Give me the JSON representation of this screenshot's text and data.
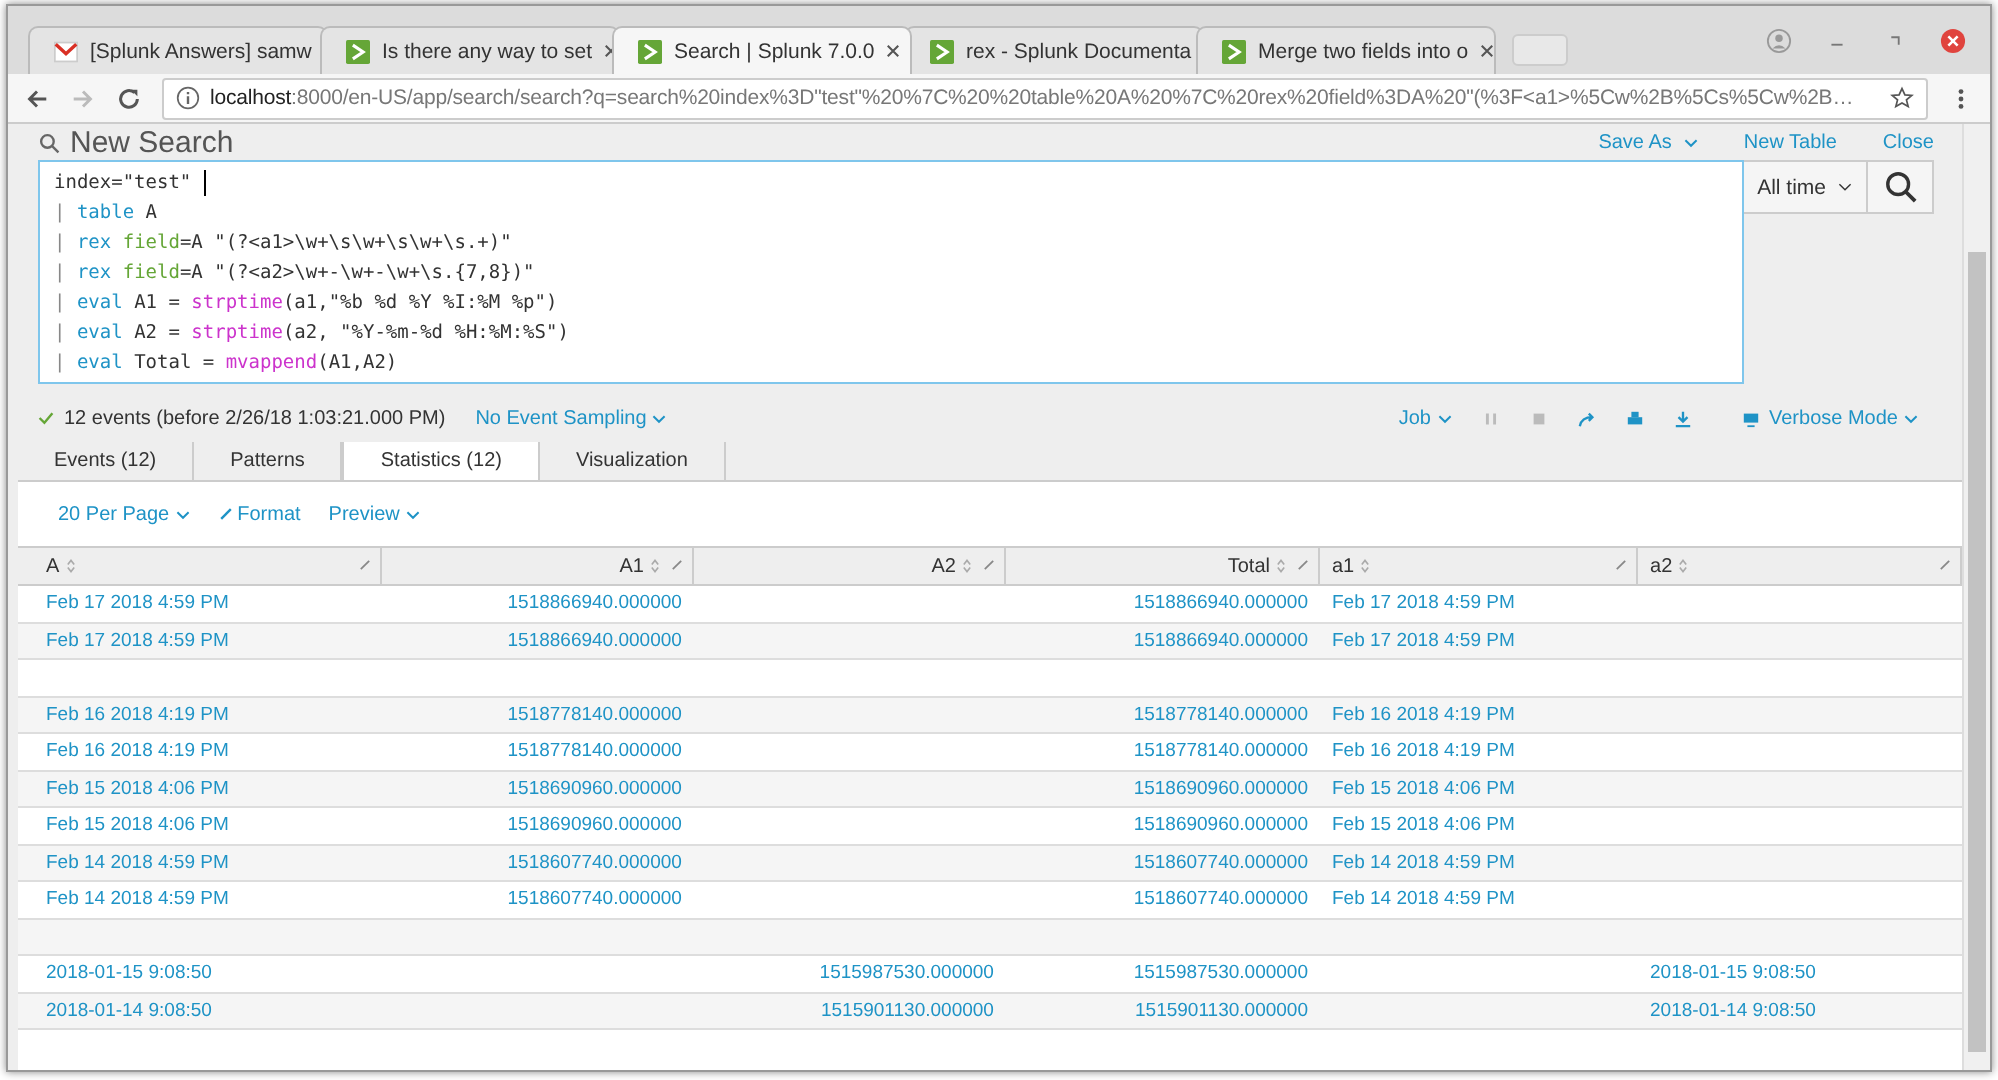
{
  "browser": {
    "tabs": [
      {
        "title": "[Splunk Answers] samw",
        "kind": "mail",
        "selected": false
      },
      {
        "title": "Is there any way to set",
        "kind": "splunk",
        "selected": false
      },
      {
        "title": "Search | Splunk 7.0.0",
        "kind": "splunk",
        "selected": true
      },
      {
        "title": "rex - Splunk Documenta",
        "kind": "splunk",
        "selected": false
      },
      {
        "title": "Merge two fields into o",
        "kind": "splunk",
        "selected": false
      }
    ],
    "url_host": "localhost",
    "url_rest": ":8000/en-US/app/search/search?q=search%20index%3D\"test\"%20%7C%20%20table%20A%20%7C%20rex%20field%3DA%20\"(%3F<a1>%5Cw%2B%5Cs%5Cw%2B…"
  },
  "page": {
    "title": "New Search",
    "links": [
      "Save As",
      "New Table",
      "Close"
    ]
  },
  "search": {
    "lines": [
      [
        {
          "text": "index=\"test\"",
          "kind": "plain"
        }
      ],
      [
        {
          "text": "| ",
          "kind": "pipe"
        },
        {
          "text": "table",
          "kind": "command"
        },
        {
          "text": " A",
          "kind": "plain"
        }
      ],
      [
        {
          "text": "| ",
          "kind": "pipe"
        },
        {
          "text": "rex",
          "kind": "command"
        },
        {
          "text": " field",
          "kind": "argument"
        },
        {
          "text": "=A \"(?<a1>\\w+\\s\\w+\\s\\w+\\s.+)\"",
          "kind": "plain"
        }
      ],
      [
        {
          "text": "| ",
          "kind": "pipe"
        },
        {
          "text": "rex",
          "kind": "command"
        },
        {
          "text": " field",
          "kind": "argument"
        },
        {
          "text": "=A \"(?<a2>\\w+-\\w+-\\w+\\s.{7,8})\"",
          "kind": "plain"
        }
      ],
      [
        {
          "text": "| ",
          "kind": "pipe"
        },
        {
          "text": "eval",
          "kind": "command"
        },
        {
          "text": " A1 = ",
          "kind": "plain"
        },
        {
          "text": "strptime",
          "kind": "function"
        },
        {
          "text": "(a1,\"%b %d %Y %I:%M %p\")",
          "kind": "plain"
        }
      ],
      [
        {
          "text": "| ",
          "kind": "pipe"
        },
        {
          "text": "eval",
          "kind": "command"
        },
        {
          "text": " A2 = ",
          "kind": "plain"
        },
        {
          "text": "strptime",
          "kind": "function"
        },
        {
          "text": "(a2, \"%Y-%m-%d %H:%M:%S\")",
          "kind": "plain"
        }
      ],
      [
        {
          "text": "| ",
          "kind": "pipe"
        },
        {
          "text": "eval",
          "kind": "command"
        },
        {
          "text": " Total = ",
          "kind": "plain"
        },
        {
          "text": "mvappend",
          "kind": "function"
        },
        {
          "text": "(A1,A2)",
          "kind": "plain"
        }
      ]
    ],
    "time_range": "All time"
  },
  "status": {
    "events": "12 events (before 2/26/18 1:03:21.000 PM)",
    "sampling": "No Event Sampling",
    "job": "Job",
    "mode": "Verbose Mode"
  },
  "result_tabs": [
    {
      "label": "Events (12)",
      "selected": false
    },
    {
      "label": "Patterns",
      "selected": false
    },
    {
      "label": "Statistics (12)",
      "selected": true
    },
    {
      "label": "Visualization",
      "selected": false
    }
  ],
  "table_options": [
    "20 Per Page",
    "Format",
    "Preview"
  ],
  "table": {
    "columns": [
      "A",
      "A1",
      "A2",
      "Total",
      "a1",
      "a2"
    ],
    "rows": [
      [
        "Feb 17 2018 4:59 PM",
        "1518866940.000000",
        null,
        "1518866940.000000",
        "Feb 17 2018 4:59 PM",
        null
      ],
      [
        "Feb 17 2018 4:59 PM",
        "1518866940.000000",
        null,
        "1518866940.000000",
        "Feb 17 2018 4:59 PM",
        null
      ],
      [
        null,
        null,
        null,
        null,
        null,
        null
      ],
      [
        "Feb 16 2018 4:19 PM",
        "1518778140.000000",
        null,
        "1518778140.000000",
        "Feb 16 2018 4:19 PM",
        null
      ],
      [
        "Feb 16 2018 4:19 PM",
        "1518778140.000000",
        null,
        "1518778140.000000",
        "Feb 16 2018 4:19 PM",
        null
      ],
      [
        "Feb 15 2018 4:06 PM",
        "1518690960.000000",
        null,
        "1518690960.000000",
        "Feb 15 2018 4:06 PM",
        null
      ],
      [
        "Feb 15 2018 4:06 PM",
        "1518690960.000000",
        null,
        "1518690960.000000",
        "Feb 15 2018 4:06 PM",
        null
      ],
      [
        "Feb 14 2018 4:59 PM",
        "1518607740.000000",
        null,
        "1518607740.000000",
        "Feb 14 2018 4:59 PM",
        null
      ],
      [
        "Feb 14 2018 4:59 PM",
        "1518607740.000000",
        null,
        "1518607740.000000",
        "Feb 14 2018 4:59 PM",
        null
      ],
      [
        null,
        null,
        null,
        null,
        null,
        null
      ],
      [
        "2018-01-15 9:08:50",
        null,
        "1515987530.000000",
        "1515987530.000000",
        null,
        "2018-01-15 9:08:50"
      ],
      [
        "2018-01-14 9:08:50",
        null,
        "1515901130.000000",
        "1515901130.000000",
        null,
        "2018-01-14 9:08:50"
      ]
    ]
  }
}
